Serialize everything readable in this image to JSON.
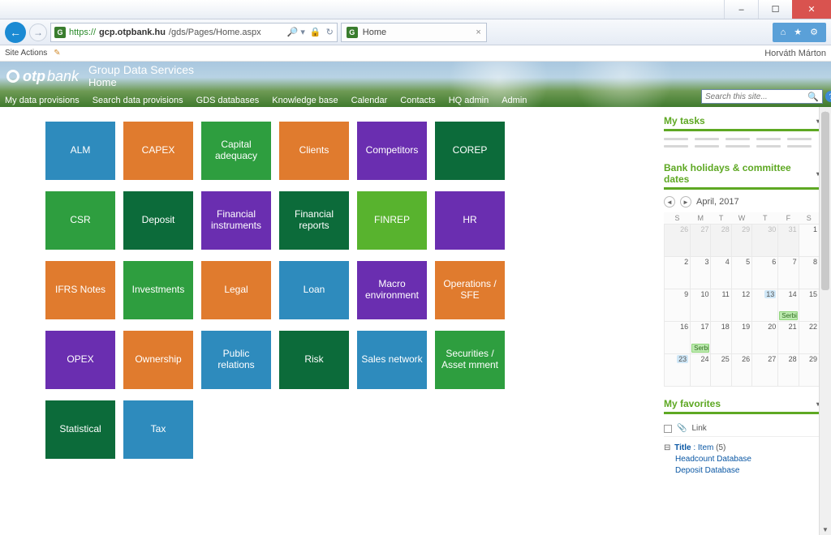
{
  "window": {
    "url_prefix": "https://",
    "url_host": "gcp.otpbank.hu",
    "url_path": "/gds/Pages/Home.aspx",
    "tab_title": "Home"
  },
  "siteactions": {
    "label": "Site Actions",
    "username": "Horváth Márton"
  },
  "banner": {
    "logo_brand": "otp",
    "logo_suffix": "bank",
    "subtitle1": "Group Data Services",
    "subtitle2": "Home",
    "search_placeholder": "Search this site..."
  },
  "nav": [
    "My data provisions",
    "Search data provisions",
    "GDS databases",
    "Knowledge base",
    "Calendar",
    "Contacts",
    "HQ admin",
    "Admin"
  ],
  "tiles": [
    {
      "label": "ALM",
      "color": "#2e8bbd"
    },
    {
      "label": "CAPEX",
      "color": "#e07b2e"
    },
    {
      "label": "Capital adequacy",
      "color": "#2e9e3f"
    },
    {
      "label": "Clients",
      "color": "#e07b2e"
    },
    {
      "label": "Competitors",
      "color": "#6a2eb0"
    },
    {
      "label": "COREP",
      "color": "#0c6b3a"
    },
    {
      "label": "CSR",
      "color": "#2e9e3f"
    },
    {
      "label": "Deposit",
      "color": "#0c6b3a"
    },
    {
      "label": "Financial instruments",
      "color": "#6a2eb0"
    },
    {
      "label": "Financial reports",
      "color": "#0c6b3a"
    },
    {
      "label": "FINREP",
      "color": "#58b32e"
    },
    {
      "label": "HR",
      "color": "#6a2eb0"
    },
    {
      "label": "IFRS Notes",
      "color": "#e07b2e"
    },
    {
      "label": "Investments",
      "color": "#2e9e3f"
    },
    {
      "label": "Legal",
      "color": "#e07b2e"
    },
    {
      "label": "Loan",
      "color": "#2e8bbd"
    },
    {
      "label": "Macro environment",
      "color": "#6a2eb0"
    },
    {
      "label": "Operations / SFE",
      "color": "#e07b2e"
    },
    {
      "label": "OPEX",
      "color": "#6a2eb0"
    },
    {
      "label": "Ownership",
      "color": "#e07b2e"
    },
    {
      "label": "Public relations",
      "color": "#2e8bbd"
    },
    {
      "label": "Risk",
      "color": "#0c6b3a"
    },
    {
      "label": "Sales network",
      "color": "#2e8bbd"
    },
    {
      "label": "Securities / Asset mment",
      "color": "#2e9e3f"
    },
    {
      "label": "Statistical",
      "color": "#0c6b3a"
    },
    {
      "label": "Tax",
      "color": "#2e8bbd"
    }
  ],
  "panels": {
    "mytasks": "My tasks",
    "holidays": "Bank holidays & committee dates",
    "favorites": "My favorites"
  },
  "calendar": {
    "month_label": "April, 2017",
    "dow": [
      "S",
      "M",
      "T",
      "W",
      "T",
      "F",
      "S"
    ],
    "weeks": [
      [
        {
          "d": 26,
          "o": true
        },
        {
          "d": 27,
          "o": true
        },
        {
          "d": 28,
          "o": true
        },
        {
          "d": 29,
          "o": true
        },
        {
          "d": 30,
          "o": true
        },
        {
          "d": 31,
          "o": true
        },
        {
          "d": 1
        }
      ],
      [
        {
          "d": 2
        },
        {
          "d": 3
        },
        {
          "d": 4
        },
        {
          "d": 5
        },
        {
          "d": 6
        },
        {
          "d": 7
        },
        {
          "d": 8
        }
      ],
      [
        {
          "d": 9
        },
        {
          "d": 10
        },
        {
          "d": 11
        },
        {
          "d": 12
        },
        {
          "d": 13,
          "today": true
        },
        {
          "d": 14,
          "event": "Serbia,"
        },
        {
          "d": 15
        }
      ],
      [
        {
          "d": 16
        },
        {
          "d": 17,
          "event": "Serbia,"
        },
        {
          "d": 18
        },
        {
          "d": 19
        },
        {
          "d": 20
        },
        {
          "d": 21
        },
        {
          "d": 22
        }
      ],
      [
        {
          "d": 23,
          "today": true
        },
        {
          "d": 24
        },
        {
          "d": 25
        },
        {
          "d": 26
        },
        {
          "d": 27
        },
        {
          "d": 28
        },
        {
          "d": 29
        }
      ]
    ]
  },
  "favorites": {
    "header_link": "Link",
    "group_prefix": "Title",
    "group_mid": " : Item ",
    "group_count": "(5)",
    "items": [
      "Headcount Database",
      "Deposit Database"
    ]
  }
}
